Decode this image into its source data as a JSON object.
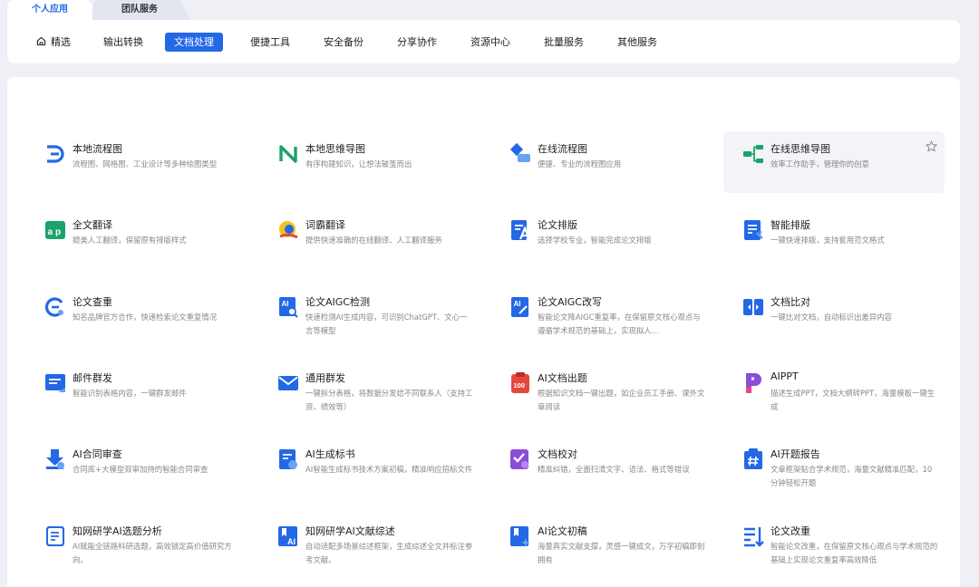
{
  "top_tabs": [
    "个人应用",
    "团队服务"
  ],
  "nav": {
    "items": [
      "精选",
      "输出转换",
      "文档处理",
      "便捷工具",
      "安全备份",
      "分享协作",
      "资源中心",
      "批量服务",
      "其他服务"
    ],
    "active": "文档处理"
  },
  "tools": [
    {
      "title": "本地流程图",
      "desc": "流程图、网格图、工业设计等多种绘图类型",
      "icon": "flowchart-d-icon"
    },
    {
      "title": "本地思维导图",
      "desc": "有序构建知识，让想法破茧而出",
      "icon": "mindmap-n-icon"
    },
    {
      "title": "在线流程图",
      "desc": "便捷、专业的流程图应用",
      "icon": "diamond-flow-icon"
    },
    {
      "title": "在线思维导图",
      "desc": "效率工作助手，管理你的创意",
      "icon": "mindmap-tree-icon"
    },
    {
      "title": "全文翻译",
      "desc": "媲美人工翻译，保留原有排版样式",
      "icon": "translate-icon"
    },
    {
      "title": "词霸翻译",
      "desc": "提供快速准确的在线翻译、人工翻译服务",
      "icon": "ciba-icon"
    },
    {
      "title": "论文排版",
      "desc": "选择学校专业，智能完成论文排版",
      "icon": "paper-layout-icon"
    },
    {
      "title": "智能排版",
      "desc": "一键快速排版，支持套用范文格式",
      "icon": "smart-layout-icon"
    },
    {
      "title": "论文查重",
      "desc": "知名品牌官方合作，快速检索论文重复情况",
      "icon": "plagiarism-icon"
    },
    {
      "title": "论文AIGC检测",
      "desc": "快速检测AI生成内容，可识别ChatGPT、文心一言等模型",
      "icon": "ai-detect-icon"
    },
    {
      "title": "论文AIGC改写",
      "desc": "智能论文降AIGC重复率，在保留原文核心观点与遵循学术规范的基础上，实现拟人...",
      "icon": "ai-rewrite-icon"
    },
    {
      "title": "文档比对",
      "desc": "一键比对文档，自动标识出差异内容",
      "icon": "compare-icon"
    },
    {
      "title": "邮件群发",
      "desc": "智能识别表格内容，一键群发邮件",
      "icon": "mail-bulk-icon"
    },
    {
      "title": "通用群发",
      "desc": "一键拆分表格，将数据分发给不同联系人（支持工资、绩效等）",
      "icon": "envelope-icon"
    },
    {
      "title": "AI文档出题",
      "desc": "根据知识文档一键出题，如企业员工手册、课外文章阅读",
      "icon": "ai-quiz-icon"
    },
    {
      "title": "AIPPT",
      "desc": "描述生成PPT，文档大纲转PPT，海量模板一键生成",
      "icon": "aippt-icon"
    },
    {
      "title": "AI合同审查",
      "desc": "合同库+大模型双审加持的智能合同审查",
      "icon": "contract-review-icon"
    },
    {
      "title": "AI生成标书",
      "desc": "AI智能生成标书技术方案初稿，精准响应招标文件",
      "icon": "bid-doc-icon"
    },
    {
      "title": "文档校对",
      "desc": "精准纠错，全面扫清文字、语法、格式等错误",
      "icon": "proofread-icon"
    },
    {
      "title": "AI开题报告",
      "desc": "文章框架贴合学术规范，海量文献精准匹配，10分钟轻松开题",
      "icon": "proposal-icon"
    },
    {
      "title": "知网研学AI选题分析",
      "desc": "AI赋能全链路科研选题，高效锁定高价值研究方向。",
      "icon": "topic-analysis-icon"
    },
    {
      "title": "知网研学AI文献综述",
      "desc": "自动适配多场景综述框架，生成综述全文并标注参考文献。",
      "icon": "lit-review-icon"
    },
    {
      "title": "AI论文初稿",
      "desc": "海量真实文献支撑，灵感一键成文，万字初稿即刻拥有",
      "icon": "paper-draft-icon"
    },
    {
      "title": "论文改重",
      "desc": "智能论文改重，在保留原文核心观点与学术规范的基础上实现论文重复率高效降低",
      "icon": "paper-rewrite-icon"
    }
  ],
  "colors": {
    "accent": "#2468e6",
    "green": "#1aa36a",
    "red": "#e5483f",
    "purple": "#8c4bd9"
  }
}
